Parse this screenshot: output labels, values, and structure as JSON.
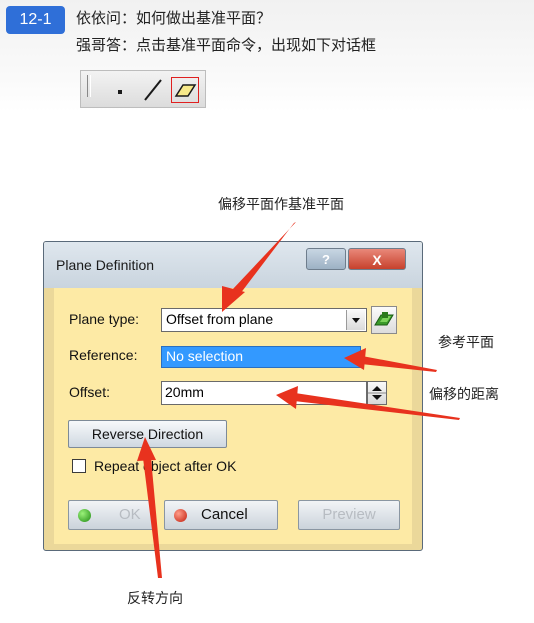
{
  "header": {
    "badge": "12-1",
    "question": "依依问：如何做出基准平面？",
    "answer": "强哥答：点击基准平面命令，出现如下对话框"
  },
  "toolbar": {
    "icons": [
      "point-icon",
      "line-icon",
      "plane-icon"
    ]
  },
  "annotations": {
    "offset_plane": "偏移平面作基准平面",
    "reference_plane": "参考平面",
    "offset_distance": "偏移的距离",
    "reverse_direction": "反转方向"
  },
  "dialog": {
    "title": "Plane Definition",
    "help_label": "?",
    "close_label": "X",
    "plane_type_label": "Plane type:",
    "plane_type_value": "Offset from plane",
    "reference_label": "Reference:",
    "reference_value": "No selection",
    "offset_label": "Offset:",
    "offset_value": "20mm",
    "reverse_label": "Reverse Direction",
    "repeat_label": "Repeat object after OK",
    "repeat_checked": false,
    "ok_label": "OK",
    "cancel_label": "Cancel",
    "preview_label": "Preview"
  },
  "colors": {
    "badge": "#2f6fd8",
    "dialog_body": "#fdeaa5",
    "selection": "#3399ff",
    "arrow": "#e8321e"
  }
}
